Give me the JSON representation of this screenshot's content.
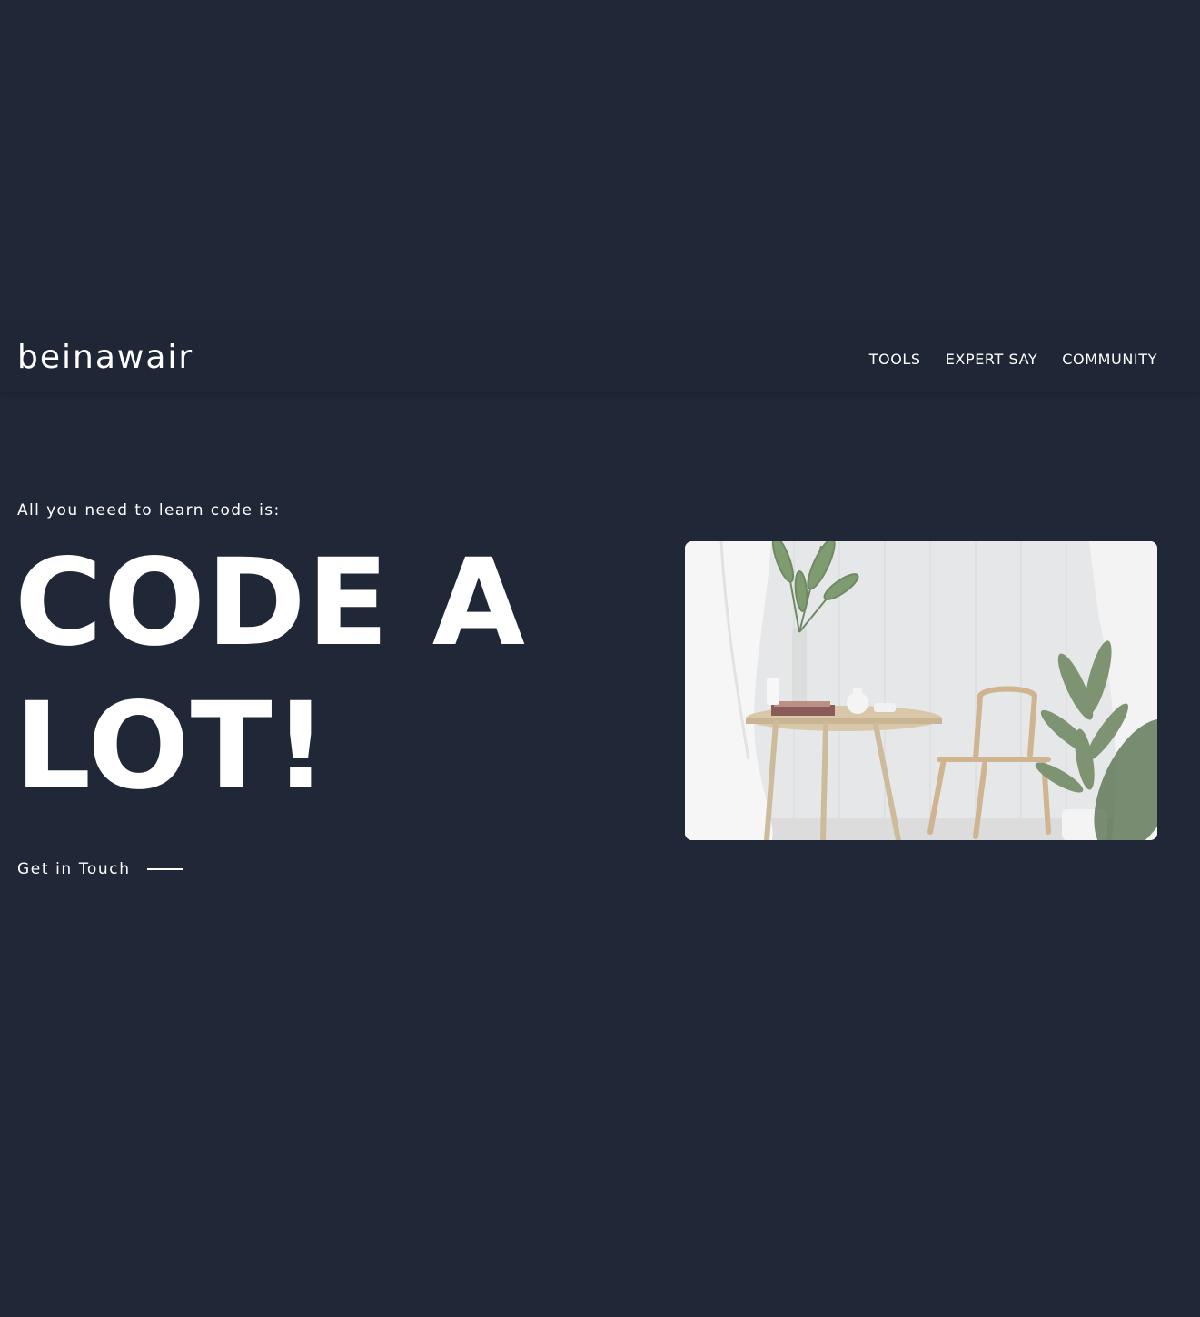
{
  "header": {
    "brand": "beinawair",
    "nav": [
      {
        "label": "TOOLS"
      },
      {
        "label": "EXPERT SAY"
      },
      {
        "label": "COMMUNITY"
      }
    ]
  },
  "hero": {
    "kicker": "All you need to learn code is:",
    "title_line1": "CODE A",
    "title_line2": "LOT!",
    "cta_label": "Get in Touch",
    "image_description_icon": "interior-photo"
  },
  "colors": {
    "background": "#202838",
    "text": "#ffffff"
  }
}
